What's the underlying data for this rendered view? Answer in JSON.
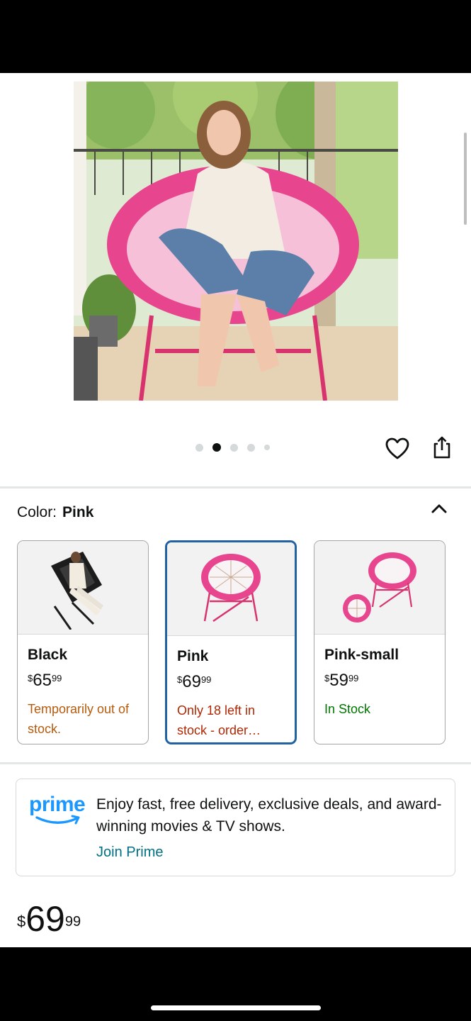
{
  "image_gallery": {
    "pages": 5,
    "active_index": 1
  },
  "color": {
    "label": "Color:",
    "selected": "Pink"
  },
  "variants": [
    {
      "name": "Black",
      "currency": "$",
      "price_whole": "65",
      "price_fraction": "99",
      "stock": "Temporarily out of stock.",
      "frame_color": "#1c1c1c"
    },
    {
      "name": "Pink",
      "currency": "$",
      "price_whole": "69",
      "price_fraction": "99",
      "stock": "Only 18 left in stock - order…",
      "frame_color": "#e8458f"
    },
    {
      "name": "Pink-small",
      "currency": "$",
      "price_whole": "59",
      "price_fraction": "99",
      "stock": "In Stock",
      "frame_color": "#e8458f"
    }
  ],
  "prime": {
    "logo_text": "prime",
    "message": "Enjoy fast, free delivery, exclusive deals, and award-winning movies & TV shows.",
    "link": "Join Prime"
  },
  "price": {
    "currency": "$",
    "whole": "69",
    "fraction": "99"
  },
  "colors": {
    "prime_blue": "#1a98ff",
    "link": "#007185",
    "selected_border": "#2162a1",
    "accent_pink": "#e8458f"
  },
  "icons": [
    "heart-icon",
    "share-icon",
    "chevron-up-icon",
    "prime-smile-icon"
  ]
}
